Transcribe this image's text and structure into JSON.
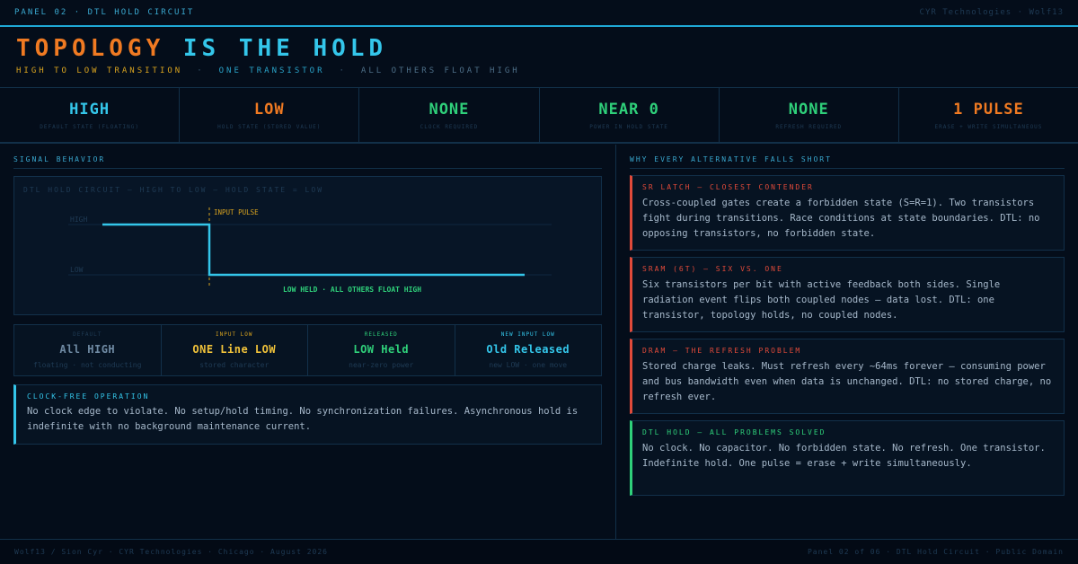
{
  "topbar": {
    "left": "PANEL 02 · DTL HOLD CIRCUIT",
    "right": "CYR Technologies · Wolf13"
  },
  "header": {
    "title_part1": "TOPOLOGY",
    "title_part2": "IS THE HOLD",
    "sub1": "HIGH TO LOW TRANSITION",
    "sep": "·",
    "sub2": "ONE TRANSISTOR",
    "sub3": "ALL OTHERS FLOAT HIGH"
  },
  "stats": [
    {
      "value": "HIGH",
      "label": "DEFAULT STATE (FLOATING)",
      "color": "#34c6ea"
    },
    {
      "value": "LOW",
      "label": "HOLD STATE (STORED VALUE)",
      "color": "#f07a22"
    },
    {
      "value": "NONE",
      "label": "CLOCK REQUIRED",
      "color": "#2fd07a"
    },
    {
      "value": "NEAR 0",
      "label": "POWER IN HOLD STATE",
      "color": "#2fd07a"
    },
    {
      "value": "NONE",
      "label": "REFRESH REQUIRED",
      "color": "#2fd07a"
    },
    {
      "value": "1 PULSE",
      "label": "ERASE + WRITE SIMULTANEOUS",
      "color": "#f07a22"
    }
  ],
  "left": {
    "section_title": "SIGNAL BEHAVIOR",
    "chart_title": "DTL HOLD CIRCUIT — HIGH TO LOW — HOLD STATE = LOW",
    "states": [
      {
        "label": "DEFAULT",
        "value": "All HIGH",
        "sub": "floating · not conducting",
        "label_color": "#1f3b55",
        "value_color": "#6f8aa3"
      },
      {
        "label": "INPUT LOW",
        "value": "ONE Line LOW",
        "sub": "stored character",
        "label_color": "#d7a21f",
        "value_color": "#f0c23a"
      },
      {
        "label": "RELEASED",
        "value": "LOW Held",
        "sub": "near-zero power",
        "label_color": "#2fd07a",
        "value_color": "#2fd07a"
      },
      {
        "label": "NEW INPUT LOW",
        "value": "Old Released",
        "sub": "new LOW · one move",
        "label_color": "#34c6ea",
        "value_color": "#34c6ea"
      }
    ],
    "clock": {
      "title": "CLOCK-FREE OPERATION",
      "body": "No clock edge to violate. No setup/hold timing. No synchronization failures. Asynchronous hold is indefinite with no background maintenance current."
    }
  },
  "chart_data": {
    "type": "line",
    "title": "DTL HOLD CIRCUIT — HIGH TO LOW — HOLD STATE = LOW",
    "y_levels": [
      "HIGH",
      "LOW"
    ],
    "series": [
      {
        "points": [
          [
            0,
            "HIGH"
          ],
          [
            1,
            "HIGH"
          ],
          [
            1,
            "LOW"
          ],
          [
            3,
            "LOW"
          ]
        ]
      }
    ],
    "annotations": [
      "INPUT PULSE",
      "LOW HELD · ALL OTHERS FLOAT HIGH"
    ],
    "colors": {
      "line": "#34c6ea",
      "pulse": "#d7a21f",
      "held": "#2fd07a"
    }
  },
  "right": {
    "section_title": "WHY EVERY ALTERNATIVE FALLS SHORT",
    "cards": [
      {
        "title": "SR LATCH — CLOSEST CONTENDER",
        "body": "Cross-coupled gates create a forbidden state (S=R=1). Two transistors fight during transitions. Race conditions at state boundaries. DTL: no opposing transistors, no forbidden state."
      },
      {
        "title": "SRAM (6T) — SIX VS. ONE",
        "body": "Six transistors per bit with active feedback both sides. Single radiation event flips both coupled nodes — data lost. DTL: one transistor, topology holds, no coupled nodes."
      },
      {
        "title": "DRAM — THE REFRESH PROBLEM",
        "body": "Stored charge leaks. Must refresh every ~64ms forever — consuming power and bus bandwidth even when data is unchanged. DTL: no stored charge, no refresh ever."
      },
      {
        "title": "DTL HOLD — ALL PROBLEMS SOLVED",
        "body": "No clock. No capacitor. No forbidden state. No refresh. One transistor. Indefinite hold. One pulse = erase + write simultaneously."
      }
    ]
  },
  "footer": {
    "left": "Wolf13 / Sion Cyr · CYR Technologies · Chicago · August 2026",
    "right": "Panel 02 of 06 · DTL Hold Circuit · Public Domain"
  }
}
